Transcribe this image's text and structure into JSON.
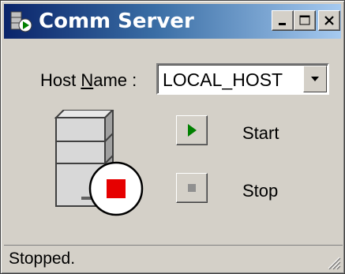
{
  "window": {
    "title": "Comm Server",
    "icons": [
      "app-server-icon",
      "minimize-icon",
      "maximize-icon",
      "close-icon"
    ]
  },
  "host": {
    "label_prefix": "Host ",
    "label_mnemonic": "N",
    "label_suffix": "ame :",
    "value": "LOCAL_HOST"
  },
  "actions": {
    "start_label": "Start",
    "stop_label": "Stop"
  },
  "server_status_icon": "server-stopped-icon",
  "status": {
    "text": "Stopped."
  },
  "colors": {
    "title_gradient_start": "#0a246a",
    "title_gradient_end": "#a6caf0",
    "start_green": "#008000",
    "stop_red": "#e60000",
    "face": "#d4d0c8"
  }
}
